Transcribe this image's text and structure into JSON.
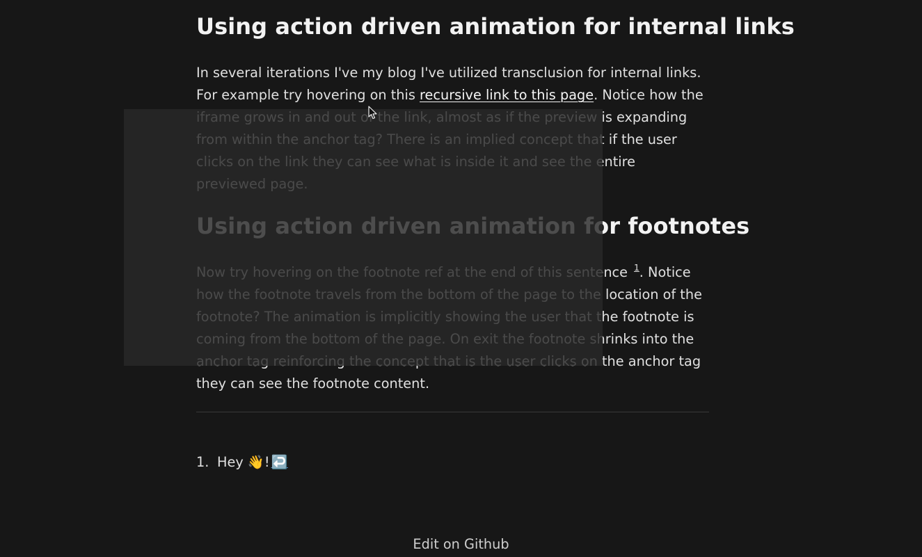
{
  "sections": {
    "internal_links": {
      "heading": "Using action driven animation for internal links",
      "text_before": "In several iterations I've my blog I've utilized transclusion for internal links. For example try hovering on this ",
      "link_label": "recursive link to this page",
      "text_after": ". Notice how the iframe grows in and out of the link, almost as if the preview is expanding from within the anchor tag? There is an implied concept that if the user clicks on the link they can see what is inside it and see the entire previewed page."
    },
    "footnotes": {
      "heading": "Using action driven animation for footnotes",
      "text_before": "Now try hovering on the footnote ref at the end of this sentence ",
      "footnote_ref": "1",
      "text_after": ". Notice how the footnote travels from the bottom of the page to the location of the footnote? The animation is implicitly showing the user that the footnote is coming from the bottom of the page. On exit the footnote shrinks into the anchor tag reinforcing the concept that is the user clicks on the anchor tag they can see the footnote content."
    }
  },
  "footnote_list": [
    {
      "number": "1.",
      "text": "Hey 👋!",
      "backref": "↩️"
    }
  ],
  "footer": {
    "edit_label": "Edit on Github"
  },
  "colors": {
    "background": "#171717",
    "text": "#e0e0e0",
    "overlay": "#282828"
  },
  "icons": {
    "cursor": "mouse-pointer-icon",
    "backref": "return-arrow-icon"
  }
}
